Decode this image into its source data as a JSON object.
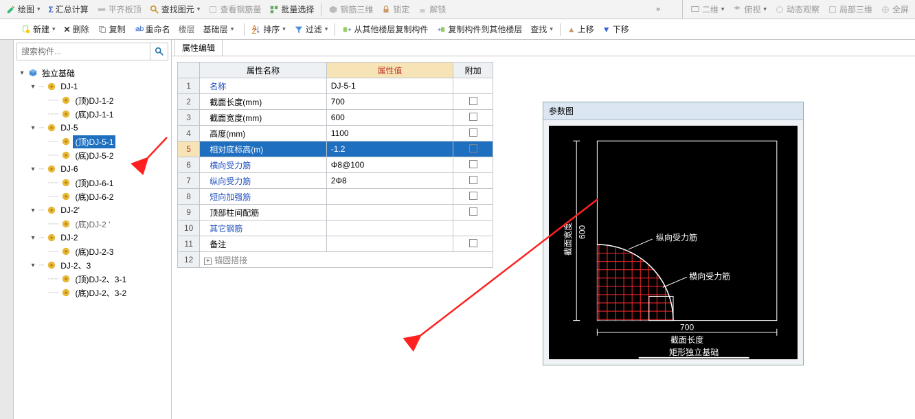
{
  "toolbar1": {
    "draw": "绘图",
    "sum": "汇总计算",
    "level": "平齐板顶",
    "findel": "查找图元",
    "viewrebar": "查看钢筋量",
    "batchsel": "批量选择",
    "rebar3d": "钢筋三维",
    "lock": "锁定",
    "unlock": "解锁",
    "r_2d": "二维",
    "r_top": "俯视",
    "r_dyn": "动态观察",
    "r_local3d": "局部三维",
    "r_full": "全屏"
  },
  "toolbar2": {
    "new": "新建",
    "del": "删除",
    "copy": "复制",
    "rename": "重命名",
    "floor": "楼层",
    "baselayer": "基础层",
    "sort": "排序",
    "filter": "过滤",
    "copyfrom": "从其他楼层复制构件",
    "copyto": "复制构件到其他楼层",
    "find": "查找",
    "up": "上移",
    "down": "下移"
  },
  "search": {
    "placeholder": "搜索构件..."
  },
  "tree": {
    "root": "独立基础",
    "n1": "DJ-1",
    "n1a": "(顶)DJ-1-2",
    "n1b": "(底)DJ-1-1",
    "n2": "DJ-5",
    "n2a": "(顶)DJ-5-1",
    "n2b": "(底)DJ-5-2",
    "n3": "DJ-6",
    "n3a": "(顶)DJ-6-1",
    "n3b": "(底)DJ-6-2",
    "n4": "DJ-2'",
    "n4a": "(底)DJ-2 '",
    "n5": "DJ-2",
    "n5a": "(底)DJ-2-3",
    "n6": "DJ-2、3",
    "n6a": "(顶)DJ-2、3-1",
    "n6b": "(底)DJ-2、3-2"
  },
  "prop": {
    "tab": "属性编辑",
    "col_name": "属性名称",
    "col_val": "属性值",
    "col_add": "附加",
    "rows": [
      {
        "n": "1",
        "name": "名称",
        "val": "DJ-5-1",
        "link": true,
        "chk": false
      },
      {
        "n": "2",
        "name": "截面长度(mm)",
        "val": "700",
        "link": false,
        "chk": true
      },
      {
        "n": "3",
        "name": "截面宽度(mm)",
        "val": "600",
        "link": false,
        "chk": true
      },
      {
        "n": "4",
        "name": "高度(mm)",
        "val": "1100",
        "link": false,
        "chk": true
      },
      {
        "n": "5",
        "name": "相对底标高(m)",
        "val": "-1.2",
        "link": true,
        "chk": true,
        "sel": true
      },
      {
        "n": "6",
        "name": "横向受力筋",
        "val": "Φ8@100",
        "link": true,
        "chk": true
      },
      {
        "n": "7",
        "name": "纵向受力筋",
        "val": "2Φ8",
        "link": true,
        "chk": true
      },
      {
        "n": "8",
        "name": "短向加强筋",
        "val": "",
        "link": true,
        "chk": true
      },
      {
        "n": "9",
        "name": "顶部柱间配筋",
        "val": "",
        "link": false,
        "chk": true
      },
      {
        "n": "10",
        "name": "其它钢筋",
        "val": "",
        "link": true,
        "chk": false
      },
      {
        "n": "11",
        "name": "备注",
        "val": "",
        "link": false,
        "chk": true
      }
    ],
    "row12_n": "12",
    "row12_label": "锚固搭接"
  },
  "diag": {
    "title": "参数图",
    "vlabel": "截面宽度",
    "vnum": "600",
    "hlabel": "截面长度",
    "hnum": "700",
    "t_long": "纵向受力筋",
    "t_trans": "横向受力筋",
    "caption": "矩形独立基础"
  }
}
